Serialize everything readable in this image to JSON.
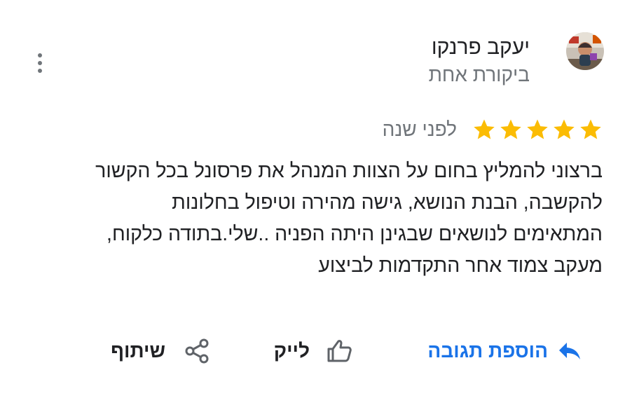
{
  "review": {
    "author_name": "יעקב פרנקו",
    "author_meta": "ביקורת אחת",
    "rating": 5,
    "rating_max": 5,
    "date": "לפני שנה",
    "text_lines": [
      "ברצוני להמליץ בחום על הצוות המנהל את פרסונל בכל הקשור",
      "להקשבה, הבנת הנושא, גישה מהירה וטיפול בחלונות",
      "המתאימים לנושאים שבגינן היתה הפניה ..שלי.בתודה כלקוח,",
      "מעקב צמוד אחר התקדמות לביצוע"
    ]
  },
  "actions": {
    "reply_label": "הוספת תגובה",
    "like_label": "לייק",
    "share_label": "שיתוף"
  },
  "icons": {
    "more": "more-vert-icon",
    "star": "star-icon",
    "reply": "reply-icon",
    "like": "thumb-up-icon",
    "share": "share-icon"
  },
  "colors": {
    "star": "#fbbc04",
    "link": "#1a73e8",
    "secondary_text": "#70757a",
    "primary_text": "#202124"
  }
}
